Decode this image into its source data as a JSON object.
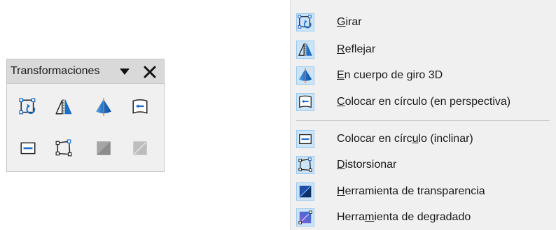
{
  "toolbar": {
    "title": "Transformaciones",
    "buttons": [
      {
        "icon": "rotate-icon",
        "enabled": true
      },
      {
        "icon": "flip-icon",
        "enabled": true
      },
      {
        "icon": "rotation-3d-icon",
        "enabled": true
      },
      {
        "icon": "circle-perspective-icon",
        "enabled": true
      },
      {
        "icon": "circle-slant-icon",
        "enabled": true
      },
      {
        "icon": "distort-icon",
        "enabled": true
      },
      {
        "icon": "transparency-icon",
        "enabled": false
      },
      {
        "icon": "gradient-icon",
        "enabled": false
      }
    ]
  },
  "menu": {
    "items": [
      {
        "pre": "",
        "key": "G",
        "post": "irar",
        "icon": "rotate-icon"
      },
      {
        "pre": "",
        "key": "R",
        "post": "eflejar",
        "icon": "flip-icon"
      },
      {
        "pre": "",
        "key": "E",
        "post": "n cuerpo de giro 3D",
        "icon": "rotation-3d-icon"
      },
      {
        "pre": "",
        "key": "C",
        "post": "olocar en círculo (en perspectiva)",
        "icon": "circle-perspective-icon"
      },
      {
        "pre": "Colocar en círc",
        "key": "u",
        "post": "lo (inclinar)",
        "icon": "circle-slant-icon"
      },
      {
        "pre": "",
        "key": "D",
        "post": "istorsionar",
        "icon": "distort-icon"
      },
      {
        "pre": "",
        "key": "H",
        "post": "erramienta de transparencia",
        "icon": "transparency-icon"
      },
      {
        "pre": "Herra",
        "key": "m",
        "post": "ienta de degradado",
        "icon": "gradient-icon"
      }
    ]
  },
  "colors": {
    "accent_blue": "#1f6fc5",
    "icon_dark": "#262626",
    "disabled_gray": "#9a9a9a",
    "highlight_bg": "#cce4f7",
    "highlight_border": "#99c9ef",
    "gradient_purple": "#8a5cd6"
  }
}
